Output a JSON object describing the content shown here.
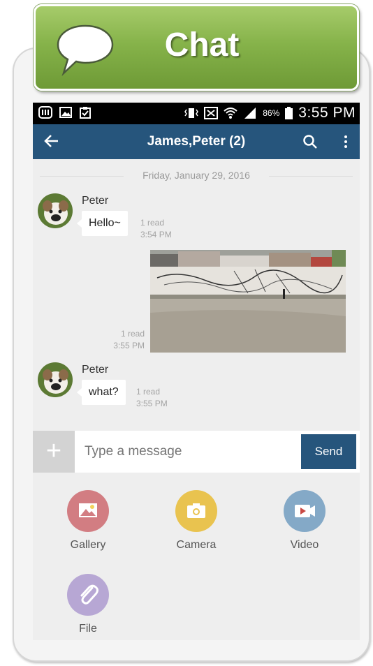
{
  "banner": {
    "title": "Chat",
    "icon": "speech-bubble-icon"
  },
  "status_bar": {
    "battery": "86%",
    "time": "3:55 PM"
  },
  "app_bar": {
    "title": "James,Peter (2)"
  },
  "date_divider": "Friday, January 29, 2016",
  "messages": [
    {
      "sender": "Peter",
      "text": "Hello~",
      "read": "1 read",
      "time": "3:54 PM"
    },
    {
      "type": "image",
      "read": "1 read",
      "time": "3:55 PM"
    },
    {
      "sender": "Peter",
      "text": "what?",
      "read": "1 read",
      "time": "3:55 PM"
    }
  ],
  "composer": {
    "placeholder": "Type a message",
    "send_label": "Send"
  },
  "attachments": [
    {
      "label": "Gallery",
      "color": "#d27d82",
      "icon": "gallery-icon"
    },
    {
      "label": "Camera",
      "color": "#e9c34f",
      "icon": "camera-icon"
    },
    {
      "label": "Video",
      "color": "#84a9c7",
      "icon": "video-icon"
    },
    {
      "label": "File",
      "color": "#b7a7d4",
      "icon": "paperclip-icon"
    }
  ],
  "colors": {
    "header_blue": "#26557c",
    "banner_green": "#86b34a"
  }
}
